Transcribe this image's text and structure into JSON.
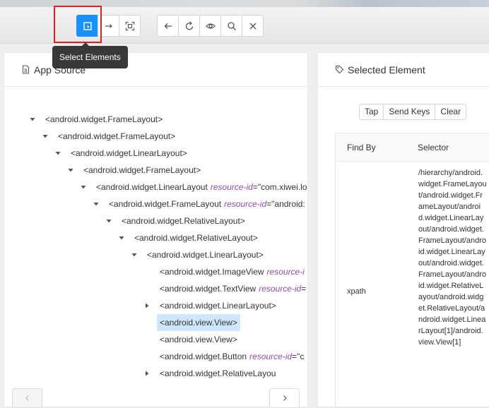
{
  "tooltip": {
    "text": "Select Elements"
  },
  "toolbar": {
    "group1": [
      {
        "name": "select-elements-button",
        "icon": "select-element-icon",
        "active": true
      },
      {
        "name": "swipe-button",
        "icon": "swipe-arrow-icon",
        "active": false
      },
      {
        "name": "tap-by-coordinates-button",
        "icon": "crosshair-frame-icon",
        "active": false
      }
    ],
    "group2": [
      {
        "name": "back-button",
        "icon": "arrow-left-icon"
      },
      {
        "name": "refresh-button",
        "icon": "refresh-icon"
      },
      {
        "name": "show-hidden-button",
        "icon": "eye-icon"
      },
      {
        "name": "search-button",
        "icon": "search-icon"
      },
      {
        "name": "quit-button",
        "icon": "close-icon"
      }
    ]
  },
  "source_panel": {
    "title": "App Source",
    "icon": "file-icon",
    "rows": [
      {
        "caret": "down",
        "tag": "<android.widget.FrameLayout>",
        "attr": "",
        "val": ""
      },
      {
        "caret": "down",
        "tag": "<android.widget.FrameLayout>",
        "attr": "",
        "val": ""
      },
      {
        "caret": "down",
        "tag": "<android.widget.LinearLayout>",
        "attr": "",
        "val": ""
      },
      {
        "caret": "down",
        "tag": "<android.widget.FrameLayout>",
        "attr": "",
        "val": ""
      },
      {
        "caret": "down",
        "tag": "<android.widget.LinearLayout",
        "attr": "resource-id",
        "val": "=\"com.xiwei.lo"
      },
      {
        "caret": "down",
        "tag": "<android.widget.FrameLayout",
        "attr": "resource-id",
        "val": "=\"android:"
      },
      {
        "caret": "down",
        "tag": "<android.widget.RelativeLayout>",
        "attr": "",
        "val": ""
      },
      {
        "caret": "down",
        "tag": "<android.widget.RelativeLayout>",
        "attr": "",
        "val": ""
      },
      {
        "caret": "down",
        "tag": "<android.widget.LinearLayout>",
        "attr": "",
        "val": ""
      },
      {
        "caret": "none",
        "tag": "<android.widget.ImageView",
        "attr": "resource-i",
        "val": ""
      },
      {
        "caret": "none",
        "tag": "<android.widget.TextView",
        "attr": "resource-id",
        "val": "="
      },
      {
        "caret": "right",
        "tag": "<android.widget.LinearLayout>",
        "attr": "",
        "val": ""
      },
      {
        "caret": "none",
        "tag": "<android.view.View>",
        "attr": "",
        "val": "",
        "selected": true
      },
      {
        "caret": "none",
        "tag": "<android.view.View>",
        "attr": "",
        "val": ""
      },
      {
        "caret": "none",
        "tag": "<android.widget.Button",
        "attr": "resource-id",
        "val": "=\"c"
      },
      {
        "caret": "right",
        "tag": "<android.widget.RelativeLayou",
        "attr": "",
        "val": ""
      }
    ]
  },
  "selected_panel": {
    "title": "Selected Element",
    "icon": "tag-icon",
    "actions": [
      "Tap",
      "Send Keys",
      "Clear"
    ],
    "table": {
      "headers": [
        "Find By",
        "Selector"
      ],
      "rows": [
        {
          "key": "xpath",
          "value": "/hierarchy/android.widget.FrameLayout/android.widget.FrameLayout/android.widget.LinearLayout/android.widget.FrameLayout/android.widget.LinearLayout/android.widget.FrameLayout/android.widget.RelativeLayout/android.widget.RelativeLayout/android.widget.LinearLayout[1]/android.view.View[1]"
        }
      ]
    }
  },
  "colors": {
    "accent": "#1890ff",
    "highlight": "#e0201f",
    "selected_bg": "#cfe6ff",
    "attr": "#8a4ea8"
  }
}
